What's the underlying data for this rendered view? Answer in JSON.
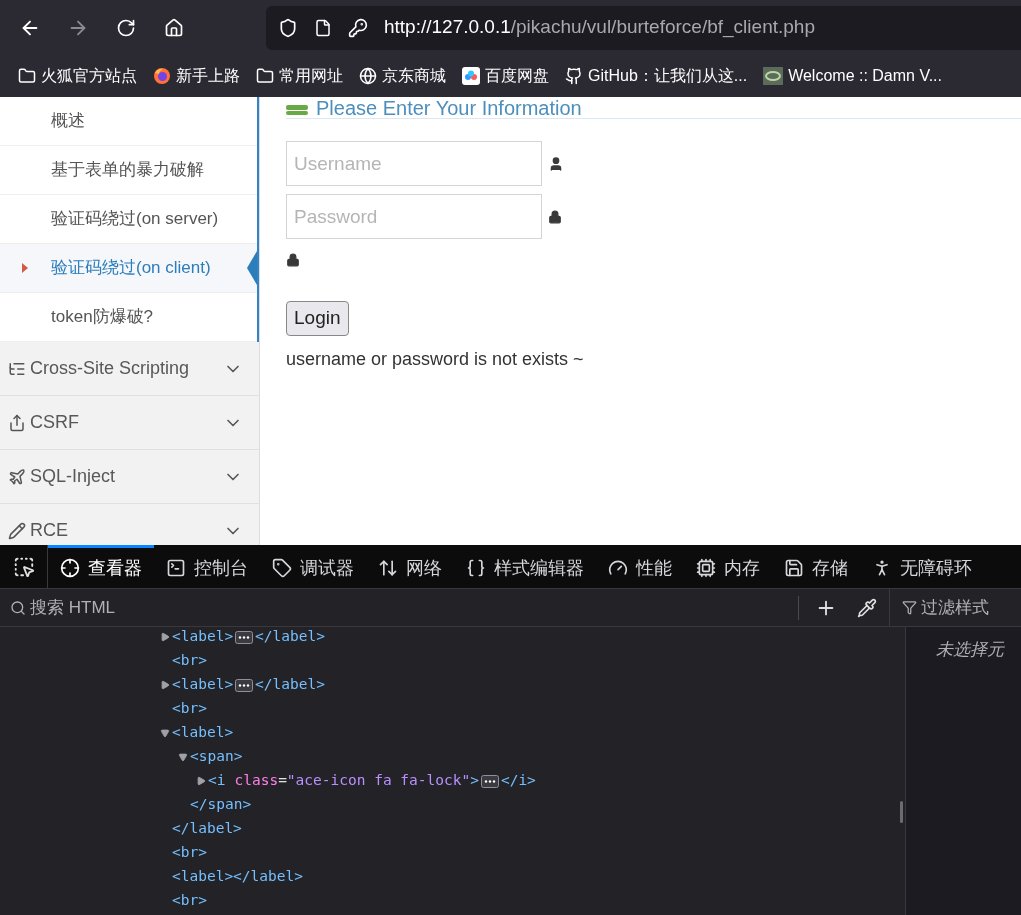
{
  "browser": {
    "url_host": "http://127.0.0.1",
    "url_path": "/pikachu/vul/burteforce/bf_client.php",
    "bookmarks": [
      {
        "kind": "folder",
        "label": "火狐官方站点"
      },
      {
        "kind": "firefox",
        "label": "新手上路"
      },
      {
        "kind": "folder",
        "label": "常用网址"
      },
      {
        "kind": "globe",
        "label": "京东商城"
      },
      {
        "kind": "cloud",
        "label": "百度网盘"
      },
      {
        "kind": "github",
        "label": "GitHub：让我们从这..."
      },
      {
        "kind": "ring",
        "label": "Welcome :: Damn V..."
      }
    ]
  },
  "sidebar": {
    "submenu": [
      {
        "label": "概述",
        "selected": false
      },
      {
        "label": "基于表单的暴力破解",
        "selected": false
      },
      {
        "label": "验证码绕过(on server)",
        "selected": false
      },
      {
        "label": "验证码绕过(on client)",
        "selected": true
      },
      {
        "label": "token防爆破?",
        "selected": false
      }
    ],
    "sections": [
      {
        "kind": "xss",
        "label": "Cross-Site Scripting"
      },
      {
        "kind": "csrf",
        "label": "CSRF"
      },
      {
        "kind": "sql",
        "label": "SQL-Inject"
      },
      {
        "kind": "rce",
        "label": "RCE"
      }
    ]
  },
  "content": {
    "heading": "Please Enter Your Information",
    "username": {
      "placeholder": "Username"
    },
    "password": {
      "placeholder": "Password"
    },
    "button": "Login",
    "message": "username or password is not exists ~"
  },
  "devtools": {
    "tabs": [
      {
        "kind": "inspector",
        "label": "查看器",
        "selected": true
      },
      {
        "kind": "console",
        "label": "控制台",
        "selected": false
      },
      {
        "kind": "debugger",
        "label": "调试器",
        "selected": false
      },
      {
        "kind": "network",
        "label": "网络",
        "selected": false
      },
      {
        "kind": "style",
        "label": "样式编辑器",
        "selected": false
      },
      {
        "kind": "performance",
        "label": "性能",
        "selected": false
      },
      {
        "kind": "memory",
        "label": "内存",
        "selected": false
      },
      {
        "kind": "storage",
        "label": "存储",
        "selected": false
      },
      {
        "kind": "accessibility",
        "label": "无障碍环",
        "selected": false
      }
    ],
    "search_placeholder": "搜索 HTML",
    "filter_placeholder": "过滤样式",
    "rules_empty": "未选择元",
    "nodes": [
      {
        "kind": "collapsed",
        "open": "<label>",
        "close": "</label>"
      },
      {
        "kind": "leaf",
        "open": "<br>"
      },
      {
        "kind": "collapsed",
        "open": "<label>",
        "close": "</label>"
      },
      {
        "kind": "leaf",
        "open": "<br>"
      },
      {
        "kind": "expanded",
        "open": "<label>",
        "close": "</label>",
        "children": [
          {
            "kind": "expanded",
            "open": "<span>",
            "close": "</span>",
            "children": [
              {
                "kind": "collapsed",
                "open": "<i",
                "attrs": [
                  {
                    "name": "class",
                    "eq": "=",
                    "value": "\"ace-icon fa fa-lock\""
                  }
                ],
                "open_end": ">",
                "close": "</i>"
              }
            ]
          }
        ]
      },
      {
        "kind": "leaf",
        "open": "<br>"
      },
      {
        "kind": "leaf",
        "open": "<label></label>"
      },
      {
        "kind": "leaf",
        "open": "<br>"
      }
    ]
  }
}
